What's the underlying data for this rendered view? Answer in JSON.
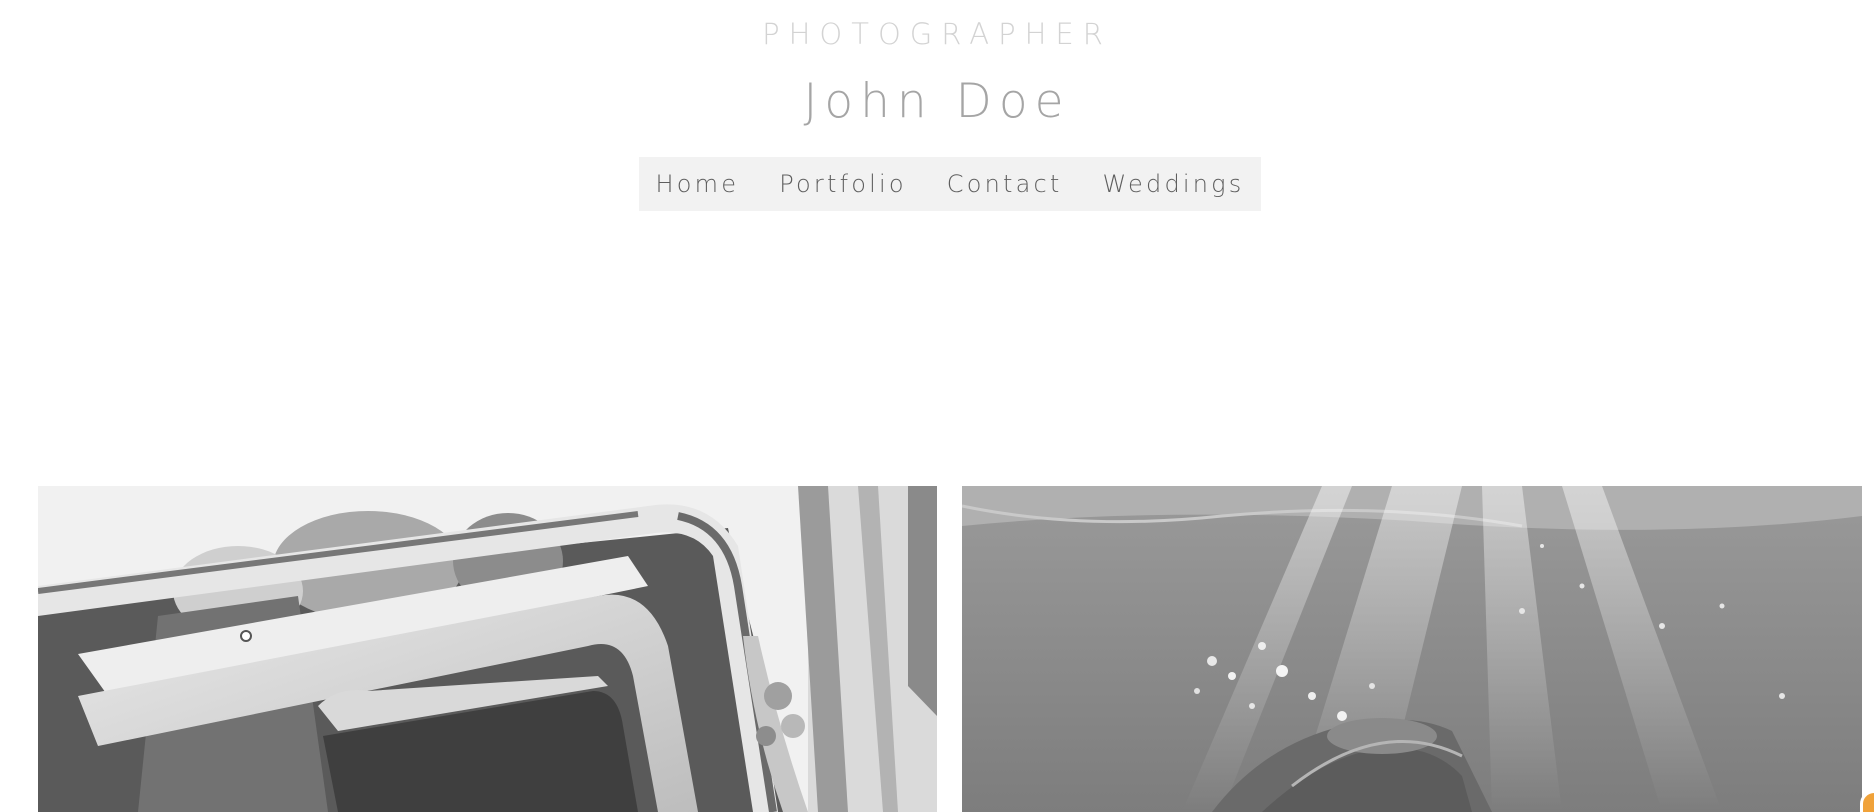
{
  "header": {
    "tagline": "PHOTOGRAPHER",
    "title": "John Doe"
  },
  "nav": {
    "items": [
      {
        "label": "Home"
      },
      {
        "label": "Portfolio"
      },
      {
        "label": "Contact"
      },
      {
        "label": "Weddings"
      }
    ]
  },
  "gallery": {
    "photos": [
      {
        "subject": "bride-in-car"
      },
      {
        "subject": "underwater-swimmer"
      }
    ]
  },
  "colors": {
    "background": "#ffffff",
    "nav_background": "#f2f2f2",
    "title": "#a5a5a5",
    "tagline": "#d3d3d3",
    "nav_text": "#5e5e5e",
    "widget_accent": "#f0a23a"
  }
}
